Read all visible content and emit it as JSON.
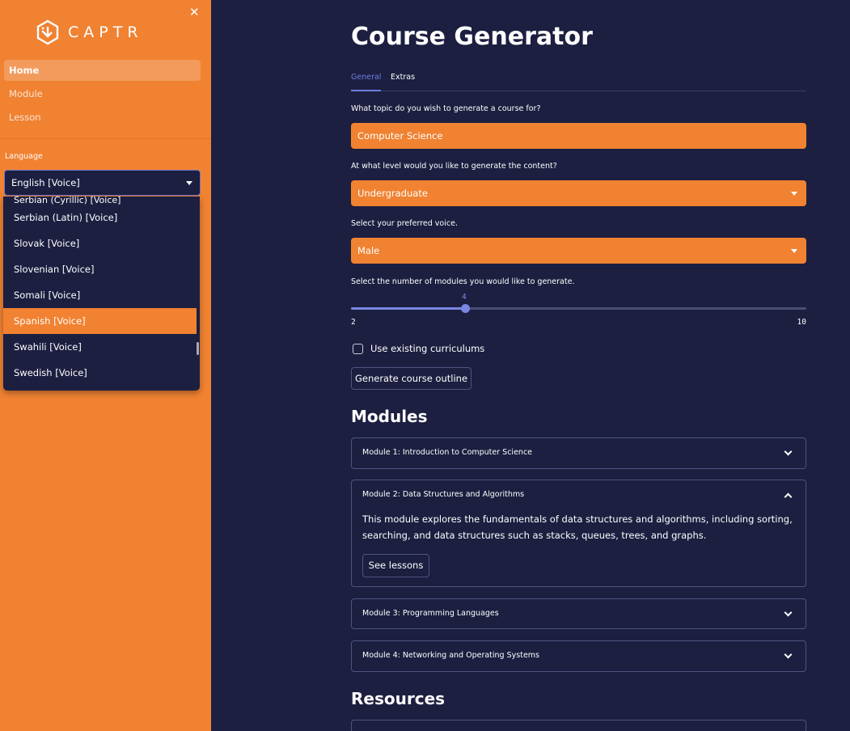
{
  "sidebar": {
    "close_label": "✕",
    "logo_text": "CAPTR",
    "nav": [
      {
        "label": "Home",
        "active": true
      },
      {
        "label": "Module",
        "active": false
      },
      {
        "label": "Lesson",
        "active": false
      }
    ],
    "language": {
      "label": "Language",
      "selected": "English [Voice]",
      "options": [
        "Serbian (Cyrillic) [Voice]",
        "Serbian (Latin) [Voice]",
        "Slovak [Voice]",
        "Slovenian [Voice]",
        "Somali [Voice]",
        "Spanish [Voice]",
        "Swahili [Voice]",
        "Swedish [Voice]"
      ],
      "highlighted": "Spanish [Voice]"
    }
  },
  "main": {
    "title": "Course Generator",
    "tabs": [
      {
        "label": "General",
        "active": true
      },
      {
        "label": "Extras",
        "active": false
      }
    ],
    "topic": {
      "label": "What topic do you wish to generate a course for?",
      "value": "Computer Science"
    },
    "level": {
      "label": "At what level would you like to generate the content?",
      "value": "Undergraduate"
    },
    "voice": {
      "label": "Select your preferred voice.",
      "value": "Male"
    },
    "modules_slider": {
      "label": "Select the number of modules you would like to generate.",
      "value": 4,
      "min": 2,
      "max": 10
    },
    "use_existing": {
      "label": "Use existing curriculums",
      "checked": false
    },
    "generate_button": "Generate course outline",
    "modules_heading": "Modules",
    "modules": [
      {
        "title": "Module 1: Introduction to Computer Science",
        "expanded": false
      },
      {
        "title": "Module 2: Data Structures and Algorithms",
        "expanded": true,
        "description": "This module explores the fundamentals of data structures and algorithms, including sorting, searching, and data structures such as stacks, queues, trees, and graphs.",
        "button": "See lessons"
      },
      {
        "title": "Module 3: Programming Languages",
        "expanded": false
      },
      {
        "title": "Module 4: Networking and Operating Systems",
        "expanded": false
      }
    ],
    "resources_heading": "Resources"
  },
  "colors": {
    "accent_orange": "#f08232",
    "background_navy": "#1c1f40",
    "slider_blue": "#7a86e0"
  }
}
